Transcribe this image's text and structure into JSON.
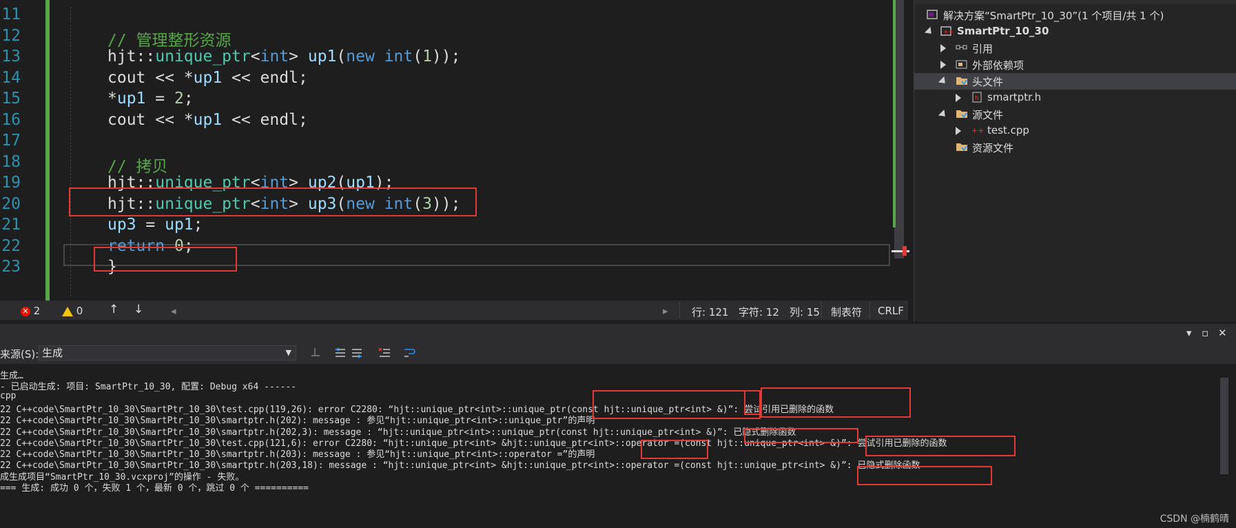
{
  "editor": {
    "line_numbers": [
      "11",
      "12",
      "13",
      "14",
      "15",
      "16",
      "17",
      "18",
      "19",
      "20",
      "21",
      "22",
      "23"
    ],
    "lines": [
      {
        "tokens": [
          {
            "t": "",
            "c": "pl"
          }
        ]
      },
      {
        "tokens": [
          {
            "t": "// 管理整形资源",
            "c": "cmt"
          }
        ]
      },
      {
        "tokens": [
          {
            "t": "hjt",
            "c": "ns"
          },
          {
            "t": "::",
            "c": "pl"
          },
          {
            "t": "unique_ptr",
            "c": "typ"
          },
          {
            "t": "<",
            "c": "pl"
          },
          {
            "t": "int",
            "c": "kw"
          },
          {
            "t": "> ",
            "c": "pl"
          },
          {
            "t": "up1",
            "c": "var"
          },
          {
            "t": "(",
            "c": "pl"
          },
          {
            "t": "new",
            "c": "kw"
          },
          {
            "t": " ",
            "c": "pl"
          },
          {
            "t": "int",
            "c": "kw"
          },
          {
            "t": "(",
            "c": "pl"
          },
          {
            "t": "1",
            "c": "num"
          },
          {
            "t": "));",
            "c": "pl"
          }
        ]
      },
      {
        "tokens": [
          {
            "t": "cout << *",
            "c": "pl"
          },
          {
            "t": "up1",
            "c": "var"
          },
          {
            "t": " << endl;",
            "c": "pl"
          }
        ]
      },
      {
        "tokens": [
          {
            "t": "*",
            "c": "pl"
          },
          {
            "t": "up1",
            "c": "var"
          },
          {
            "t": " = ",
            "c": "pl"
          },
          {
            "t": "2",
            "c": "num"
          },
          {
            "t": ";",
            "c": "pl"
          }
        ]
      },
      {
        "tokens": [
          {
            "t": "cout << *",
            "c": "pl"
          },
          {
            "t": "up1",
            "c": "var"
          },
          {
            "t": " << endl;",
            "c": "pl"
          }
        ]
      },
      {
        "tokens": [
          {
            "t": "",
            "c": "pl"
          }
        ]
      },
      {
        "tokens": [
          {
            "t": "// 拷贝",
            "c": "cmt"
          }
        ]
      },
      {
        "tokens": [
          {
            "t": "hjt",
            "c": "ns"
          },
          {
            "t": "::",
            "c": "pl"
          },
          {
            "t": "unique_ptr",
            "c": "typ"
          },
          {
            "t": "<",
            "c": "pl"
          },
          {
            "t": "int",
            "c": "kw"
          },
          {
            "t": "> ",
            "c": "pl"
          },
          {
            "t": "up2",
            "c": "var"
          },
          {
            "t": "(",
            "c": "pl"
          },
          {
            "t": "up1",
            "c": "var"
          },
          {
            "t": ");",
            "c": "pl"
          }
        ]
      },
      {
        "tokens": [
          {
            "t": "hjt",
            "c": "ns"
          },
          {
            "t": "::",
            "c": "pl"
          },
          {
            "t": "unique_ptr",
            "c": "typ"
          },
          {
            "t": "<",
            "c": "pl"
          },
          {
            "t": "int",
            "c": "kw"
          },
          {
            "t": "> ",
            "c": "pl"
          },
          {
            "t": "up3",
            "c": "var"
          },
          {
            "t": "(",
            "c": "pl"
          },
          {
            "t": "new",
            "c": "kw"
          },
          {
            "t": " ",
            "c": "pl"
          },
          {
            "t": "int",
            "c": "kw"
          },
          {
            "t": "(",
            "c": "pl"
          },
          {
            "t": "3",
            "c": "num"
          },
          {
            "t": "));",
            "c": "pl"
          }
        ]
      },
      {
        "tokens": [
          {
            "t": "up3",
            "c": "var"
          },
          {
            "t": " = ",
            "c": "pl"
          },
          {
            "t": "up1",
            "c": "var"
          },
          {
            "t": ";",
            "c": "pl"
          }
        ]
      },
      {
        "tokens": [
          {
            "t": "return",
            "c": "kw"
          },
          {
            "t": " ",
            "c": "pl"
          },
          {
            "t": "0",
            "c": "num"
          },
          {
            "t": ";",
            "c": "pl"
          }
        ]
      },
      {
        "tokens": [
          {
            "t": "}",
            "c": "pl"
          }
        ]
      }
    ]
  },
  "statusbar": {
    "errors": "2",
    "warnings": "0",
    "line": "行: 121",
    "char": "字符: 12",
    "col": "列: 15",
    "tabs": "制表符",
    "eol": "CRLF"
  },
  "explorer": {
    "solution": "解决方案“SmartPtr_10_30”(1 个项目/共 1 个)",
    "project": "SmartPtr_10_30",
    "references": "引用",
    "external": "外部依赖项",
    "headers": "头文件",
    "header_file": "smartptr.h",
    "sources": "源文件",
    "source_file": "test.cpp",
    "resources": "资源文件"
  },
  "output": {
    "source_label": "来源(S):",
    "source_value": "生成",
    "lines": [
      "生成…",
      "- 已启动生成: 项目: SmartPtr_10_30, 配置: Debug x64 ------",
      "cpp",
      "22 C++code\\SmartPtr_10_30\\SmartPtr_10_30\\test.cpp(119,26): error C2280: “hjt::unique_ptr<int>::unique_ptr(const hjt::unique_ptr<int> &)”: 尝试引用已删除的函数",
      "22 C++code\\SmartPtr_10_30\\SmartPtr_10_30\\smartptr.h(202): message : 参见“hjt::unique_ptr<int>::unique_ptr”的声明",
      "22 C++code\\SmartPtr_10_30\\SmartPtr_10_30\\smartptr.h(202,3): message : “hjt::unique_ptr<int>::unique_ptr(const hjt::unique_ptr<int> &)”: 已隐式删除函数",
      "22 C++code\\SmartPtr_10_30\\SmartPtr_10_30\\test.cpp(121,6): error C2280: “hjt::unique_ptr<int> &hjt::unique_ptr<int>::operator =(const hjt::unique_ptr<int> &)”: 尝试引用已删除的函数",
      "22 C++code\\SmartPtr_10_30\\SmartPtr_10_30\\smartptr.h(203): message : 参见“hjt::unique_ptr<int>::operator =”的声明",
      "22 C++code\\SmartPtr_10_30\\SmartPtr_10_30\\smartptr.h(203,18): message : “hjt::unique_ptr<int> &hjt::unique_ptr<int>::operator =(const hjt::unique_ptr<int> &)”: 已隐式删除函数",
      "成生成项目“SmartPtr_10_30.vcxproj”的操作 - 失败。",
      "=== 生成: 成功 0 个，失败 1 个，最新 0 个，跳过 0 个 =========="
    ]
  },
  "watermark": "CSDN @楠鹤晴",
  "colors": {
    "accent_red": "#e53935",
    "change_green": "#57a64a"
  }
}
